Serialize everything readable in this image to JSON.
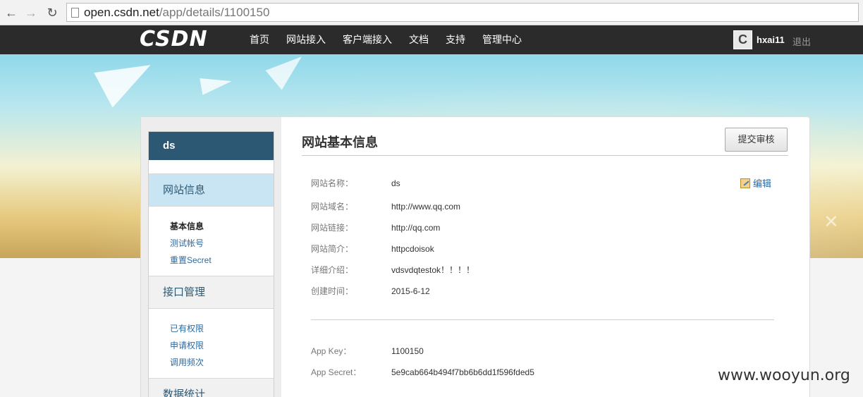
{
  "browser": {
    "url_host": "open.csdn.net",
    "url_path": "/app/details/1100150"
  },
  "topnav": {
    "logo": "CSDN",
    "items": [
      "首页",
      "网站接入",
      "客户端接入",
      "文档",
      "支持",
      "管理中心"
    ],
    "user": {
      "avatar_letter": "C",
      "name": "hxai11",
      "logout": "退出"
    }
  },
  "sidebar": {
    "app_name": "ds",
    "sections": [
      {
        "title": "网站信息",
        "links": [
          "基本信息",
          "测试帐号",
          "重置Secret"
        ]
      },
      {
        "title": "接口管理",
        "links": [
          "已有权限",
          "申请权限",
          "调用频次"
        ]
      },
      {
        "title": "数据统计"
      }
    ]
  },
  "content": {
    "title": "网站基本信息",
    "submit_button": "提交审核",
    "edit_label": "编辑",
    "fields": [
      {
        "label": "网站名称：",
        "value": "ds"
      },
      {
        "label": "网站域名：",
        "value": "http://www.qq.com"
      },
      {
        "label": "网站链接：",
        "value": "http://qq.com"
      },
      {
        "label": "网站简介：",
        "value": "httpcdoisok"
      },
      {
        "label": "详细介绍：",
        "value": "vdsvdqtestok！！！！"
      },
      {
        "label": "创建时间：",
        "value": "2015-6-12"
      }
    ],
    "keys": [
      {
        "label": "App Key：",
        "value": "1100150"
      },
      {
        "label": "App Secret：",
        "value": "5e9cab664b494f7bb6b6dd1f596fded5"
      }
    ]
  },
  "watermark": "www.wooyun.org"
}
